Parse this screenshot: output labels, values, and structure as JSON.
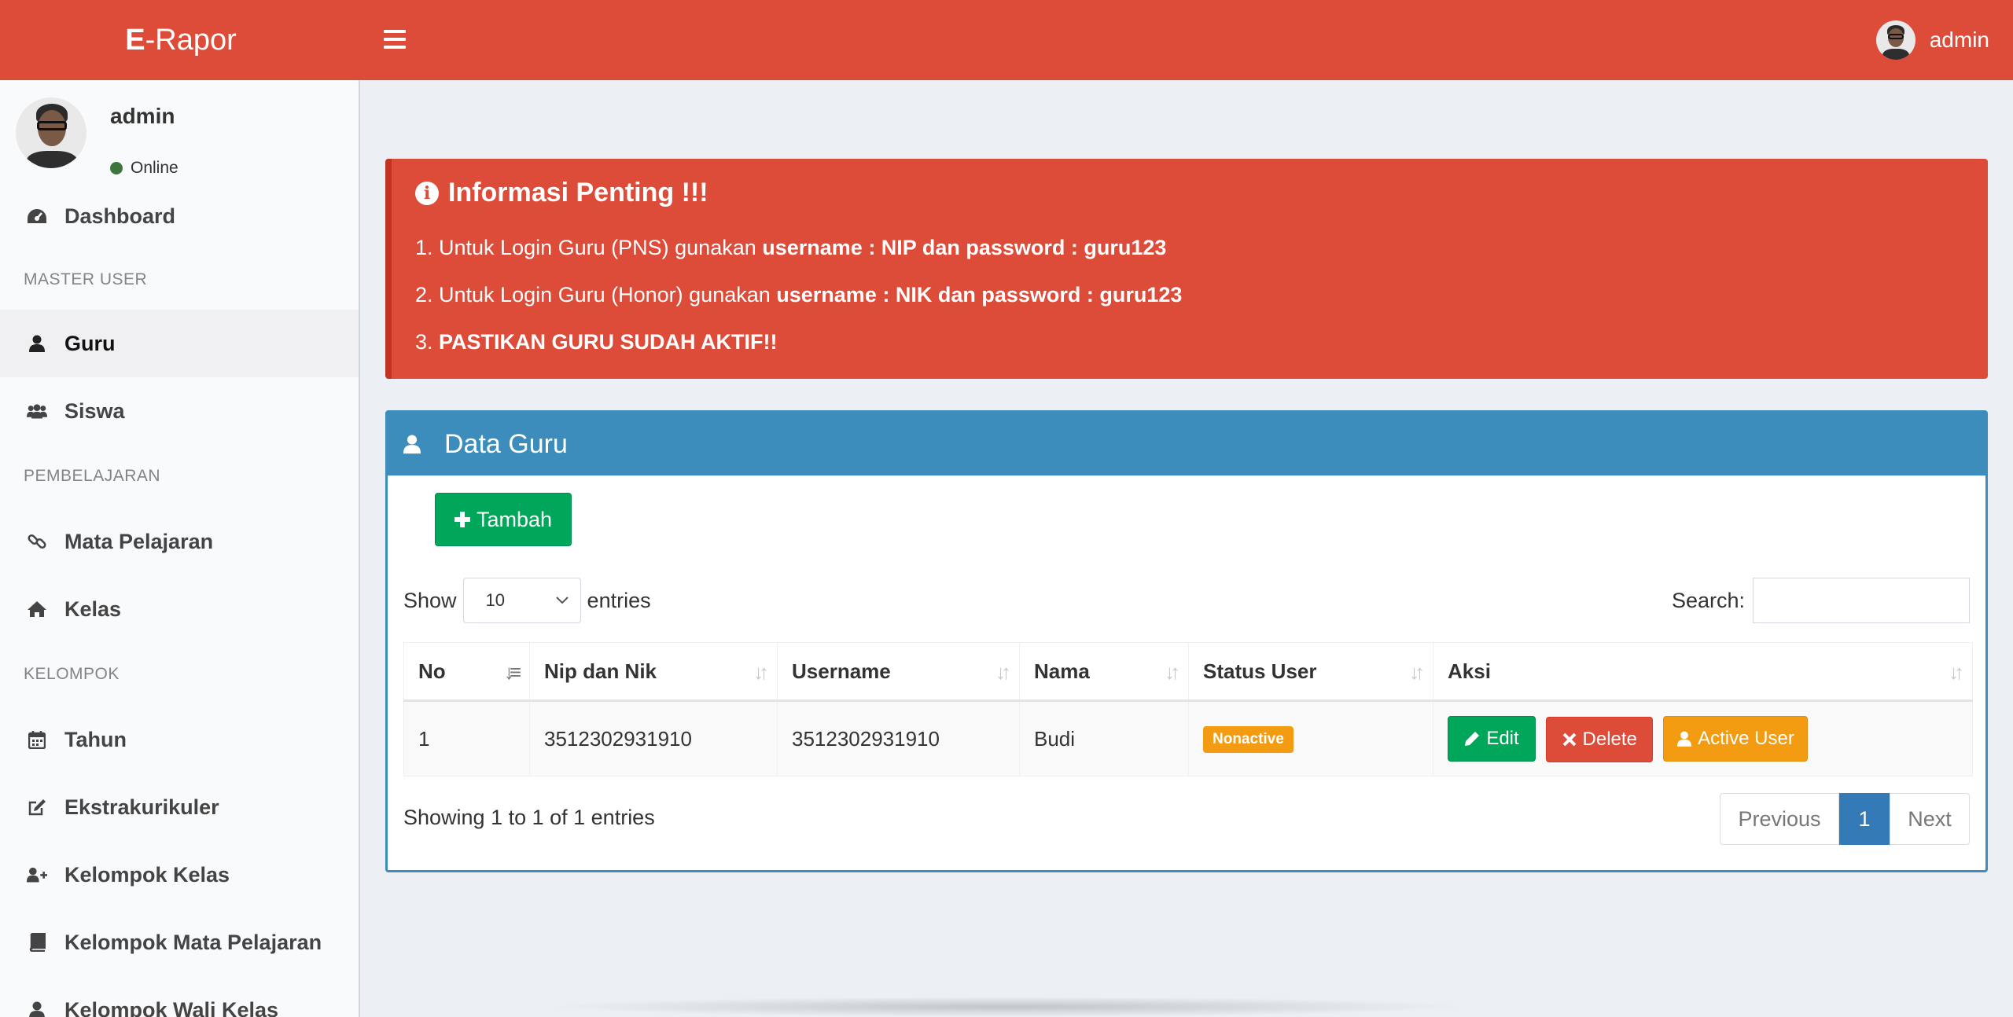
{
  "header": {
    "logo_bold": "E",
    "logo_rest": "-Rapor",
    "user_name": "admin"
  },
  "sidebar": {
    "user": {
      "name": "admin",
      "status": "Online"
    },
    "items": [
      {
        "label": "Dashboard",
        "icon": "dashboard-icon"
      },
      {
        "label": "Guru",
        "icon": "user-icon",
        "active": true
      },
      {
        "label": "Siswa",
        "icon": "users-icon"
      },
      {
        "label": "Mata Pelajaran",
        "icon": "link-icon"
      },
      {
        "label": "Kelas",
        "icon": "home-icon"
      },
      {
        "label": "Tahun",
        "icon": "calendar-icon"
      },
      {
        "label": "Ekstrakurikuler",
        "icon": "edit-icon"
      },
      {
        "label": "Kelompok Kelas",
        "icon": "user-plus-icon"
      },
      {
        "label": "Kelompok Mata Pelajaran",
        "icon": "book-icon"
      },
      {
        "label": "Kelompok Wali Kelas",
        "icon": "user-tie-icon"
      }
    ],
    "headers": [
      "MASTER USER",
      "PEMBELAJARAN",
      "KELOMPOK"
    ]
  },
  "alert": {
    "title": "Informasi Penting !!!",
    "line1_prefix": "1. Untuk Login Guru (PNS) gunakan ",
    "line1_bold": "username : NIP dan password : guru123",
    "line2_prefix": "2. Untuk Login Guru (Honor) gunakan ",
    "line2_bold": "username : NIK dan password : guru123",
    "line3_prefix": "3. ",
    "line3_bold": "PASTIKAN GURU SUDAH AKTIF!!"
  },
  "box": {
    "title": "Data Guru",
    "add_button": "Tambah",
    "show_label": "Show",
    "entries_value": "10",
    "entries_label": "entries",
    "search_label": "Search:",
    "columns": [
      "No",
      "Nip dan Nik",
      "Username",
      "Nama",
      "Status User",
      "Aksi"
    ],
    "rows": [
      {
        "no": "1",
        "nip": "3512302931910",
        "username": "3512302931910",
        "nama": "Budi",
        "status": "Nonactive",
        "actions": {
          "edit": "Edit",
          "delete": "Delete",
          "activate": "Active User"
        }
      }
    ],
    "info": "Showing 1 to 1 of 1 entries",
    "pagination": {
      "previous": "Previous",
      "current": "1",
      "next": "Next"
    }
  },
  "colors": {
    "header_red": "#dd4b39",
    "box_blue": "#3c8dbc",
    "success_green": "#00a65a",
    "warning_orange": "#f39c12",
    "page_blue": "#337ab7"
  }
}
